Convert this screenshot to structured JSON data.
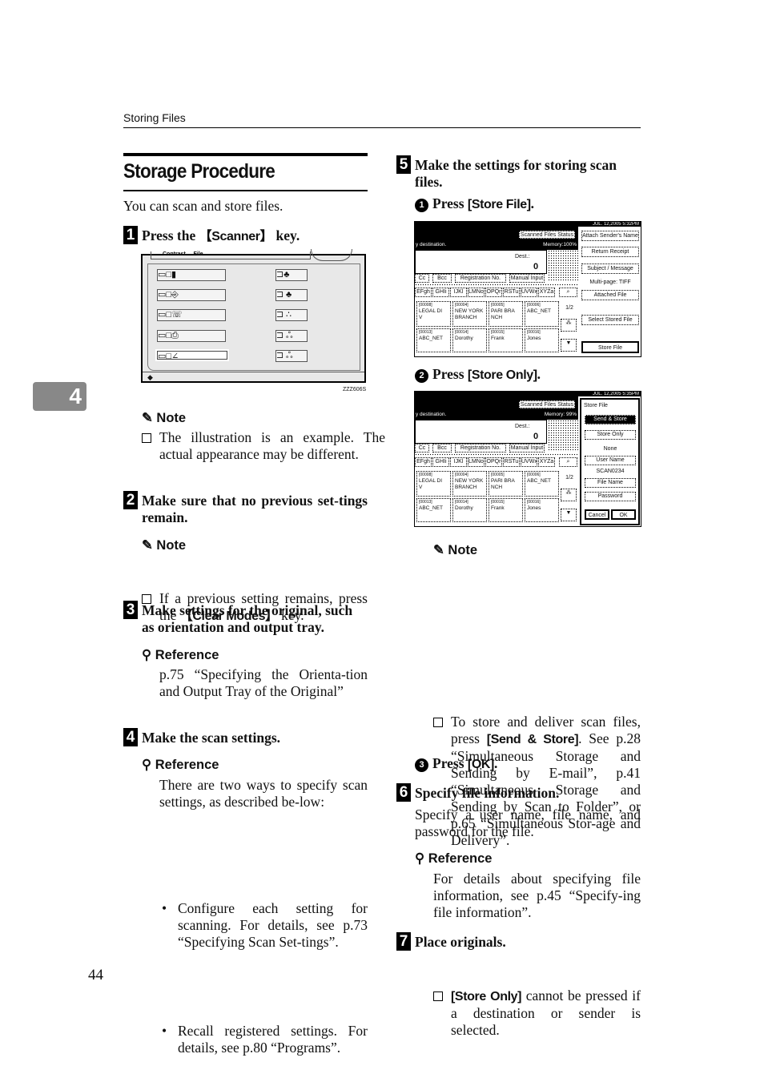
{
  "header": {
    "running_title": "Storing Files"
  },
  "chapter_tab": "4",
  "page_number": "44",
  "section": {
    "title": "Storage Procedure",
    "intro": "You can scan and store files."
  },
  "steps": [
    {
      "num": "1",
      "pre": "Press the ",
      "key": "【Scanner】",
      "post": " key."
    },
    {
      "num": "2",
      "text": "Make sure that no previous set-tings remain."
    },
    {
      "num": "3",
      "text": "Make settings for the original, such as orientation and output tray."
    },
    {
      "num": "4",
      "text": "Make the scan settings."
    },
    {
      "num": "5",
      "text": "Make the settings for storing scan files."
    },
    {
      "num": "6",
      "text": "Specify file information."
    },
    {
      "num": "7",
      "text": "Place originals."
    }
  ],
  "note_label": "Note",
  "reference_label": "Reference",
  "step1": {
    "note": "The illustration is an example. The actual appearance may be different.",
    "figure_code": "ZZZ606S",
    "panel_labels": [
      "Contrast",
      "File"
    ]
  },
  "step2": {
    "note_pre": "If a previous setting remains, press the ",
    "note_key": "【Clear Modes】",
    "note_post": " key."
  },
  "step3": {
    "reference": "p.75 “Specifying the Orienta-tion and Output Tray of the Original”"
  },
  "step4": {
    "reference": "There are two ways to specify scan settings, as described be-low:",
    "bullets": [
      "Configure each setting for scanning. For details, see p.73 “Specifying Scan Set-tings”.",
      "Recall registered settings. For details, see p.80 “Programs”."
    ]
  },
  "step5": {
    "substeps": [
      {
        "circ": "1",
        "pre": "Press ",
        "key": "[Store File]",
        "post": "."
      },
      {
        "circ": "2",
        "pre": "Press ",
        "key": "[Store Only]",
        "post": "."
      },
      {
        "circ": "3",
        "pre": "Press ",
        "key": "[OK]",
        "post": "."
      }
    ],
    "note1_pre": "To store and deliver scan files, press ",
    "note1_key": "[Send & Store]",
    "note1_post": ". See p.28 “Simultaneous Storage and Sending by E-mail”, p.41 “Simultaneous Storage and Sending by Scan to Folder”, or p.65 “Simultaneous Stor-age and Delivery”.",
    "note2_key": "[Store Only]",
    "note2_post": " cannot be pressed if a destination or sender is selected."
  },
  "step6": {
    "text": "Specify a user name, file name, and password for the file.",
    "reference": "For details about specifying file information, see p.45 “Specify-ing file information”."
  },
  "screen_common": {
    "status_btn": "Scanned Files Status",
    "dest_hint": "y destination.",
    "dest_label": "Dest.:",
    "dest_count": "0",
    "tabs": [
      "Cc",
      "Bcc",
      "Registration No.",
      "Manual Input"
    ],
    "letters": [
      "EFgh",
      "GHIi",
      "IJKl",
      "LMNo",
      "OPQr",
      "RSTu",
      "UVWx",
      "XYZa"
    ],
    "entries": [
      {
        "id": "[00008]",
        "name": "LEGAL DI\nV"
      },
      {
        "id": "[00004]",
        "name": "NEW YORK\nBRANCH"
      },
      {
        "id": "[00005]",
        "name": "PARI BRA\nNCH"
      },
      {
        "id": "[00006]",
        "name": "ABC_NET"
      },
      {
        "id": "[00013]",
        "name": "ABC_NET"
      },
      {
        "id": "[00014]",
        "name": "Dorothy"
      },
      {
        "id": "[00015]",
        "name": "Frank"
      },
      {
        "id": "[00016]",
        "name": "Jones"
      }
    ],
    "page": "1/2"
  },
  "screen1": {
    "datetime": "JUL. 12,2005 5:32PM",
    "memory": "Memory:100%",
    "right": [
      "Attach Sender's Name",
      "Return Receipt",
      "Subject / Message"
    ],
    "format": "Multi-page: TIFF",
    "attached": "Attached File",
    "select_stored": "Select Stored File",
    "store_file": "Store File"
  },
  "screen2": {
    "datetime": "JUL. 12,2005 5:35PM",
    "memory": "Memory: 99%",
    "panel_title": "Store File",
    "send_store": "Send & Store",
    "store_only": "Store Only",
    "user_value": "None",
    "user_btn": "User Name",
    "file_value": "SCAN0234",
    "file_btn": "File Name",
    "password_btn": "Password",
    "cancel": "Cancel",
    "ok": "OK"
  }
}
